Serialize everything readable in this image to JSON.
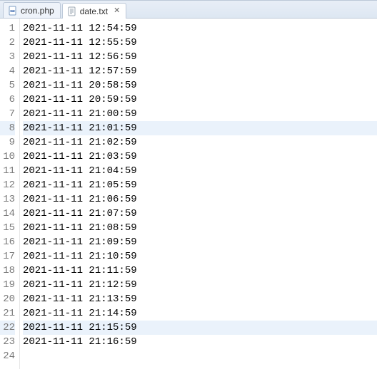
{
  "tabs": [
    {
      "label": "cron.php",
      "icon": "php-file-icon",
      "active": false,
      "closable": false
    },
    {
      "label": "date.txt",
      "icon": "text-file-icon",
      "active": true,
      "closable": true
    }
  ],
  "close_glyph": "✕",
  "highlighted_lines": [
    8,
    22
  ],
  "lines": [
    "2021-11-11 12:54:59",
    "2021-11-11 12:55:59",
    "2021-11-11 12:56:59",
    "2021-11-11 12:57:59",
    "2021-11-11 20:58:59",
    "2021-11-11 20:59:59",
    "2021-11-11 21:00:59",
    "2021-11-11 21:01:59",
    "2021-11-11 21:02:59",
    "2021-11-11 21:03:59",
    "2021-11-11 21:04:59",
    "2021-11-11 21:05:59",
    "2021-11-11 21:06:59",
    "2021-11-11 21:07:59",
    "2021-11-11 21:08:59",
    "2021-11-11 21:09:59",
    "2021-11-11 21:10:59",
    "2021-11-11 21:11:59",
    "2021-11-11 21:12:59",
    "2021-11-11 21:13:59",
    "2021-11-11 21:14:59",
    "2021-11-11 21:15:59",
    "2021-11-11 21:16:59",
    ""
  ]
}
